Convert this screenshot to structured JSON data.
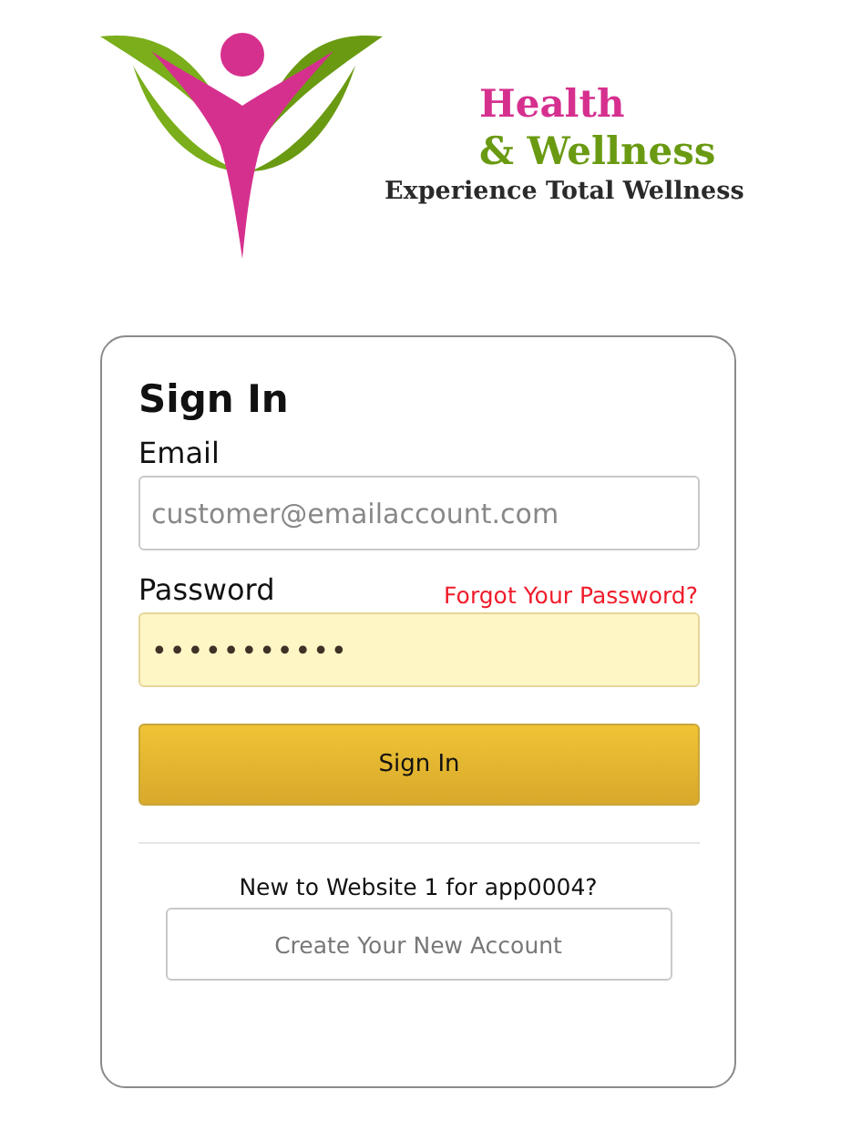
{
  "logo": {
    "line_1": "Health",
    "line_2": "& Wellness",
    "tagline": "Experience Total Wellness"
  },
  "sign_in": {
    "title": "Sign In",
    "email": {
      "label": "Email",
      "placeholder": "customer@emailaccount.com"
    },
    "password": {
      "label": "Password",
      "value": "•••••••••••",
      "autofilled": true
    },
    "forgot_link": "Forgot Your Password?",
    "submit": "Sign In",
    "new_prompt": "New to Website 1 for app0004?",
    "create_account": "Create Your New Account"
  }
}
